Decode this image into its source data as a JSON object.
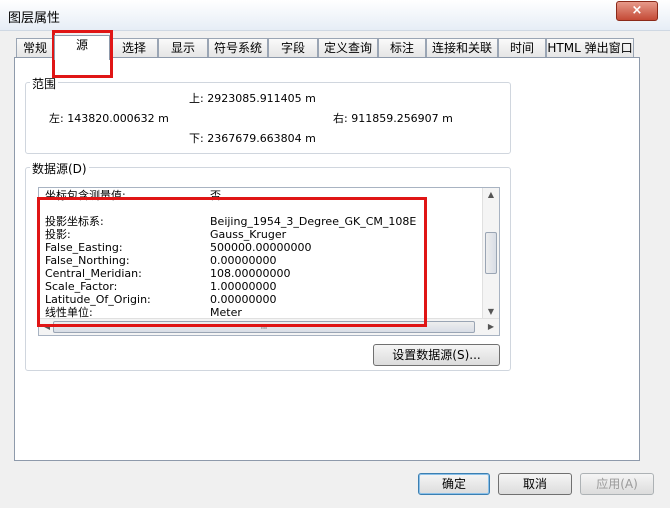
{
  "window": {
    "title": "图层属性",
    "close_icon": "×"
  },
  "tabs": [
    {
      "label": "常规"
    },
    {
      "label": "源"
    },
    {
      "label": "选择"
    },
    {
      "label": "显示"
    },
    {
      "label": "符号系统"
    },
    {
      "label": "字段"
    },
    {
      "label": "定义查询"
    },
    {
      "label": "标注"
    },
    {
      "label": "连接和关联"
    },
    {
      "label": "时间"
    },
    {
      "label": "HTML 弹出窗口"
    }
  ],
  "extent": {
    "title": "范围",
    "top": "上:  2923085.911405 m",
    "left": "左: 143820.000632 m",
    "right": "右:  911859.256907 m",
    "bottom": "下:  2367679.663804 m"
  },
  "datasource": {
    "title": "数据源(D)",
    "rows": [
      {
        "key": "坐标包含测量值:",
        "value": "否"
      },
      {
        "key": "",
        "value": ""
      },
      {
        "key": "投影坐标系:",
        "value": "Beijing_1954_3_Degree_GK_CM_108E"
      },
      {
        "key": "投影:",
        "value": "Gauss_Kruger"
      },
      {
        "key": "False_Easting:",
        "value": "500000.00000000"
      },
      {
        "key": "False_Northing:",
        "value": "0.00000000"
      },
      {
        "key": "Central_Meridian:",
        "value": "108.00000000"
      },
      {
        "key": "Scale_Factor:",
        "value": "1.00000000"
      },
      {
        "key": "Latitude_Of_Origin:",
        "value": "0.00000000"
      },
      {
        "key": "线性单位:",
        "value": "Meter"
      }
    ],
    "scroll_thumb_grip": "III",
    "set_button": "设置数据源(S)..."
  },
  "buttons": {
    "ok": "确定",
    "cancel": "取消",
    "apply": "应用(A)"
  },
  "colors": {
    "highlight": "#e01515",
    "panel": "#ffffff",
    "window_bg": "#f0f0f0"
  }
}
